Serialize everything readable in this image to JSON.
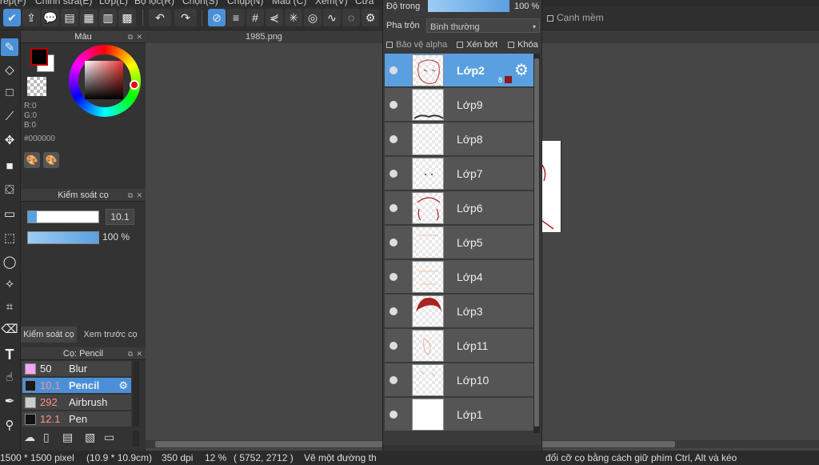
{
  "menu": [
    "rep(F)",
    "Chinh sửa(E)",
    "Lớp(L)",
    "Bộ lọc(R)",
    "Chọn(S)",
    "Chụp(N)",
    "Màu (C)",
    "Xem(V)",
    "Cửa"
  ],
  "canvas_tab": "1985.png",
  "color_panel": {
    "title": "Màu",
    "r": "R:0",
    "g": "G:0",
    "b": "B:0",
    "hex": "#000000",
    "fg_color": "#000000",
    "bg_color": "#ffffff"
  },
  "brush_control": {
    "title": "Kiểm soát cọ",
    "size_value": "10.1",
    "opacity_value": "100 %",
    "size_fraction": 0.12,
    "opacity_fraction": 1.0,
    "tabs": [
      "Kiểm soát cọ",
      "Xem trước cọ"
    ]
  },
  "brush_list": {
    "title": "Cọ: Pencil",
    "items": [
      {
        "size": "50",
        "name": "Blur",
        "color": "#f4a6f4",
        "selected": false
      },
      {
        "size": "10.1",
        "name": "Pencil",
        "color": "#1a1a1a",
        "selected": true
      },
      {
        "size": "292",
        "name": "Airbrush",
        "color": "#cccccc",
        "selected": false
      },
      {
        "size": "12.1",
        "name": "Pen",
        "color": "#111111",
        "selected": false
      }
    ]
  },
  "layer_panel": {
    "opacity_label": "Độ trong",
    "opacity_value": "100 %",
    "blend_label": "Pha trộn",
    "blend_value": "Bình thường",
    "protect_alpha": "Bảo vệ alpha",
    "clip": "Xén bớt",
    "lock": "Khóa",
    "layers": [
      {
        "name": "Lớp2",
        "selected": true,
        "badge": "8"
      },
      {
        "name": "Lớp9",
        "selected": false
      },
      {
        "name": "Lớp8",
        "selected": false
      },
      {
        "name": "Lớp7",
        "selected": false
      },
      {
        "name": "Lớp6",
        "selected": false
      },
      {
        "name": "Lớp5",
        "selected": false
      },
      {
        "name": "Lớp4",
        "selected": false
      },
      {
        "name": "Lớp3",
        "selected": false
      },
      {
        "name": "Lớp11",
        "selected": false
      },
      {
        "name": "Lớp10",
        "selected": false
      },
      {
        "name": "Lớp1",
        "selected": false
      }
    ]
  },
  "subtoolbar": {
    "soft_edge": "Cạnh mềm"
  },
  "status": {
    "size": "1500 * 1500 pixel",
    "cm": "(10.9 * 10.9cm)",
    "dpi": "350 dpi",
    "zoom": "12 %",
    "coords": "( 5752, 2712 )",
    "hint_left": "Vẽ một đường th",
    "hint_right": "đổi cỡ cọ bằng cách giữ phím Ctrl, Alt và kéo"
  },
  "colors": {
    "accent": "#4a90d9",
    "selected_layer": "#5aa0e0"
  }
}
